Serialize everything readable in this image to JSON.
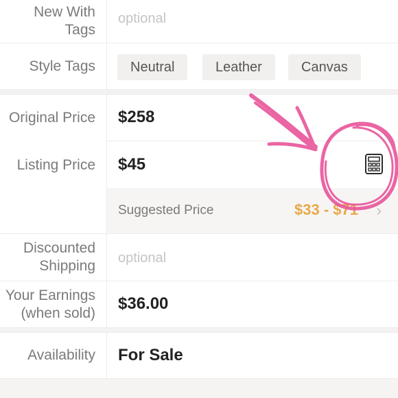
{
  "rows": {
    "nwt": {
      "label": "New With Tags",
      "placeholder": "optional"
    },
    "style_tags": {
      "label": "Style Tags",
      "tags": [
        "Neutral",
        "Leather",
        "Canvas"
      ]
    },
    "original_price": {
      "label": "Original Price",
      "value": "$258"
    },
    "listing_price": {
      "label": "Listing Price",
      "value": "$45"
    },
    "suggested": {
      "label": "Suggested Price",
      "value": "$33 - $71"
    },
    "discounted_shipping": {
      "label": "Discounted Shipping",
      "placeholder": "optional"
    },
    "earnings": {
      "label": "Your Earnings (when sold)",
      "value": "$36.00"
    },
    "availability": {
      "label": "Availability",
      "value": "For Sale"
    }
  },
  "icons": {
    "calculator": "calculator-icon",
    "chevron": "chevron-right-icon"
  },
  "colors": {
    "suggested_value": "#e8a94a",
    "annotation": "#e8559a"
  }
}
